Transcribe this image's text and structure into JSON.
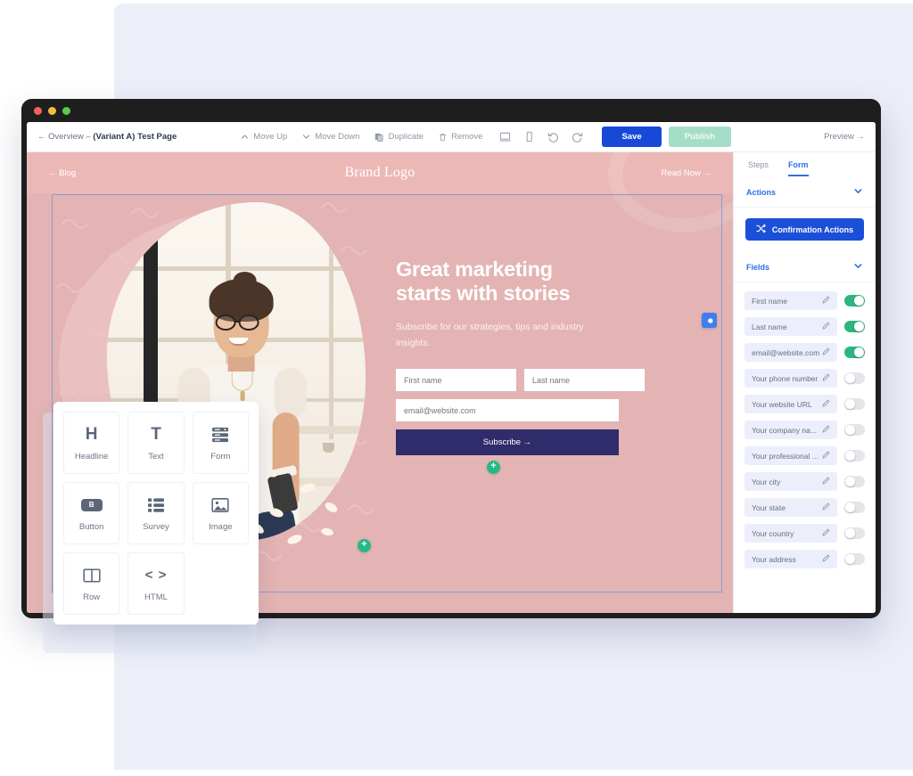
{
  "window": {
    "traffic_lights": [
      "close",
      "minimize",
      "maximize"
    ]
  },
  "toolbar": {
    "breadcrumb_prefix": "← Overview – ",
    "breadcrumb_page": "(Variant A) Test Page",
    "move_up": "Move Up",
    "move_down": "Move Down",
    "duplicate": "Duplicate",
    "remove": "Remove",
    "save_label": "Save",
    "publish_label": "Publish",
    "preview_label": "Preview →",
    "save_color": "#1849d6",
    "publish_color": "#a5dec8"
  },
  "page": {
    "nav_left": "← Blog",
    "brand": "Brand Logo",
    "nav_right": "Read Now →",
    "headline_line1": "Great marketing",
    "headline_line2": "starts with stories",
    "subhead": "Subscribe for our strategies, tips and industry insights.",
    "form": {
      "first_name_placeholder": "First name",
      "last_name_placeholder": "Last name",
      "email_placeholder": "email@website.com",
      "submit_label": "Subscribe →",
      "submit_color": "#302b6b"
    },
    "hero_bg": "#e3b4b3"
  },
  "sidebar": {
    "tabs": [
      {
        "label": "Steps",
        "active": false
      },
      {
        "label": "Form",
        "active": true
      }
    ],
    "actions_section": "Actions",
    "confirmation_actions_label": "Confirmation Actions",
    "fields_section": "Fields",
    "fields": [
      {
        "label": "First name",
        "enabled": true
      },
      {
        "label": "Last name",
        "enabled": true
      },
      {
        "label": "email@website.com",
        "enabled": true
      },
      {
        "label": "Your phone number",
        "enabled": false
      },
      {
        "label": "Your website URL",
        "enabled": false
      },
      {
        "label": "Your company na...",
        "enabled": false
      },
      {
        "label": "Your professional ...",
        "enabled": false
      },
      {
        "label": "Your city",
        "enabled": false
      },
      {
        "label": "Your state",
        "enabled": false
      },
      {
        "label": "Your country",
        "enabled": false
      },
      {
        "label": "Your address",
        "enabled": false
      }
    ],
    "accent_color": "#2f6fe4",
    "toggle_on_color": "#2bb680"
  },
  "widget_picker": {
    "items": [
      {
        "label": "Headline",
        "icon": "headline-icon"
      },
      {
        "label": "Text",
        "icon": "text-icon"
      },
      {
        "label": "Form",
        "icon": "form-icon"
      },
      {
        "label": "Button",
        "icon": "button-icon"
      },
      {
        "label": "Survey",
        "icon": "survey-icon"
      },
      {
        "label": "Image",
        "icon": "image-icon"
      },
      {
        "label": "Row",
        "icon": "row-icon"
      },
      {
        "label": "HTML",
        "icon": "html-icon"
      }
    ]
  }
}
